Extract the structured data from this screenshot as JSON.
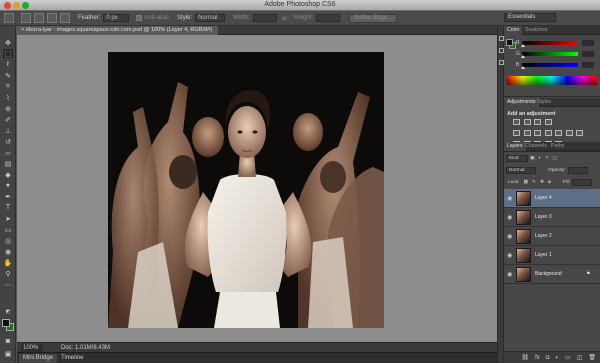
{
  "window": {
    "title": "Adobe Photoshop CS6"
  },
  "options_bar": {
    "feather_label": "Feather:",
    "feather_value": "0 px",
    "anti_alias_label": "Anti-alias",
    "style_label": "Style:",
    "style_value": "Normal",
    "width_label": "Width:",
    "height_label": "Height:",
    "refine_edge_label": "Refine Edge...",
    "workspace_value": "Essentials"
  },
  "document": {
    "tab_label": "elezra-iyar - images.squarespace-cdn.com.psd @ 100% (Layer 4, RGB/8#)",
    "close_glyph": "×"
  },
  "status": {
    "zoom": "100%",
    "doc_info": "Doc: 1.01M/8.43M"
  },
  "bottom_tabs": [
    "Mini Bridge",
    "Timeline"
  ],
  "color_panel": {
    "tabs": [
      "Color",
      "Swatches"
    ],
    "channels": [
      {
        "label": "R",
        "value": ""
      },
      {
        "label": "G",
        "value": ""
      },
      {
        "label": "B",
        "value": ""
      }
    ],
    "foreground": "#111111",
    "background": "#1e6e1e"
  },
  "adjustments_panel": {
    "tabs": [
      "Adjustments",
      "Styles"
    ],
    "title": "Add an adjustment"
  },
  "layers_panel": {
    "tabs": [
      "Layers",
      "Channels",
      "Paths"
    ],
    "filter_value": "Kind",
    "blend_mode": "Normal",
    "opacity_label": "Opacity:",
    "opacity_value": "",
    "lock_label": "Lock:",
    "fill_label": "Fill:",
    "fill_value": "",
    "layers": [
      {
        "name": "Layer 4",
        "selected": true
      },
      {
        "name": "Layer 3",
        "selected": false
      },
      {
        "name": "Layer 2",
        "selected": false
      },
      {
        "name": "Layer 1",
        "selected": false
      },
      {
        "name": "Background",
        "selected": false,
        "locked": true
      }
    ]
  }
}
